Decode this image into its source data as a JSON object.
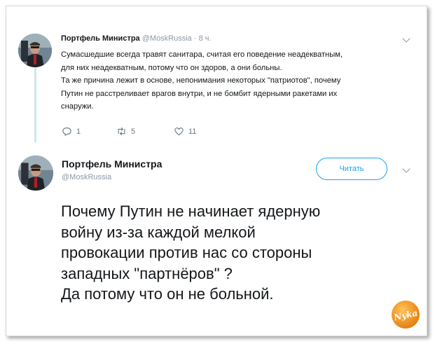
{
  "tweet1": {
    "author_name": "Портфель Министра",
    "handle": "@MoskRussia",
    "separator": "·",
    "time": "8 ч.",
    "text_lines": [
      "Сумасшедшие всегда травят санитара, считая его поведение неадекватным,",
      "для них неадекватным, потому что он здоров, а они больны.",
      "Та же причина лежит в основе, непонимания некоторых \"патриотов\", почему",
      "Путин не расстреливает врагов внутри, и не бомбит ядерными ракетами их",
      "снаружи."
    ],
    "actions": {
      "replies": "1",
      "retweets": "5",
      "likes": "11"
    }
  },
  "tweet2": {
    "author_name": "Портфель Министра",
    "handle": "@MoskRussia",
    "follow_label": "Читать",
    "text_lines": [
      "Почему Путин не начинает ядерную",
      "войну из-за каждой мелкой",
      "провокации против нас со стороны",
      "западных \"партнёров\" ?",
      "Да потому что он не больной."
    ]
  },
  "watermark": {
    "text": "Nyka"
  },
  "icons": {
    "reply": "reply-icon",
    "retweet": "retweet-icon",
    "like": "heart-icon",
    "more": "chevron-down-icon"
  },
  "colors": {
    "accent": "#1da1f2",
    "secondary_text": "#657786",
    "thread_line": "#cde8e8",
    "logo_orange": "#f39a1e"
  }
}
